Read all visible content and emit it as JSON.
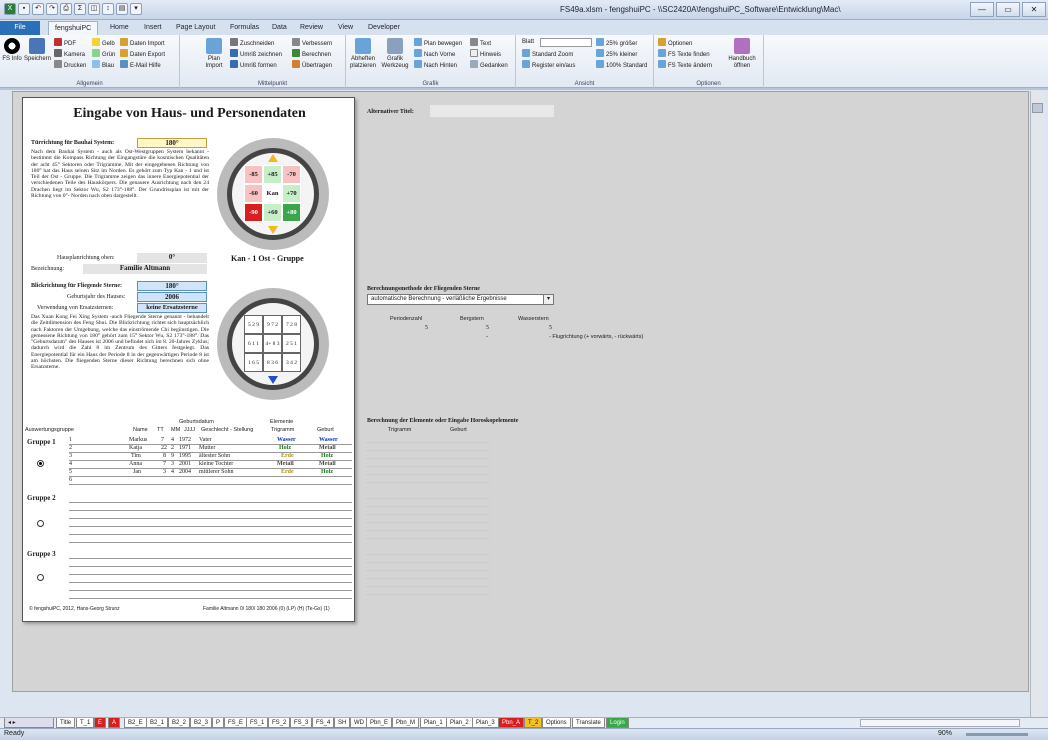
{
  "window": {
    "title": "FS49a.xlsm - fengshuiPC - \\\\SC2420A\\fengshuiPC_Software\\Entwicklung\\Mac\\",
    "btn_min": "—",
    "btn_max": "▭",
    "btn_close": "✕"
  },
  "tabs": [
    "File",
    "fengshuiPC",
    "Home",
    "Insert",
    "Page Layout",
    "Formulas",
    "Data",
    "Review",
    "View",
    "Developer"
  ],
  "ribbon": {
    "allgemein": {
      "label": "Allgemein",
      "fs_info": "FS Info",
      "speichern": "Speichern",
      "pdf": "PDF",
      "kamera": "Kamera",
      "drucken": "Drucken",
      "gelb": "Gelb",
      "gruen": "Grün",
      "blau": "Blau",
      "daten_import": "Daten Import",
      "daten_export": "Daten Export",
      "email": "E-Mail Hilfe"
    },
    "mittelpunkt": {
      "label": "Mittelpunkt",
      "plan_import": "Plan Import",
      "zuschneiden": "Zuschneiden",
      "umriss_zeichnen": "Umriß zeichnen",
      "umriss_formen": "Umriß formen",
      "verbessern": "Verbessern",
      "berechnen": "Berechnen",
      "uebertragen": "Übertragen"
    },
    "grafik": {
      "label": "Grafik",
      "abheften": "Abheften platzieren",
      "werkzeug": "Grafik Werkzeug",
      "plan_bewegen": "Plan bewegen",
      "nach_vorne": "Nach Vorne",
      "nach_hinten": "Nach Hinten",
      "text": "Text",
      "hinweis": "Hinweis",
      "gedanken": "Gedanken"
    },
    "ansicht": {
      "label": "Ansicht",
      "blatt": "Blatt",
      "standard_zoom": "Standard Zoom",
      "register": "Register ein/aus",
      "groesser": "25% größer",
      "kleiner": "25% kleiner",
      "standard100": "100% Standard"
    },
    "optionen": {
      "label": "Optionen",
      "optionen": "Optionen",
      "texte_finden": "FS Texte finden",
      "texte_aendern": "FS Texte ändern",
      "handbuch": "Handbuch öffnen"
    }
  },
  "form": {
    "title": "Eingabe von Haus- und Personendaten",
    "tuer_label": "Türrichtung für Bauhai System:",
    "tuer_value": "180°",
    "tuer_text": "Nach dem Bauhai System - auch als Ost-Westgruppen System bekannt - bestimmt die Kompass Richtung der Eingangstüre die kosmischen Qualitäten der acht 45° Sektoren oder Trigramme. Mit der eingegebenen Richtung von 180° hat das Haus seinen Sitz im Norden. Es gehört zum Typ Kan - 1 und ist Teil der Ost - Gruppe. Die Trigramme zeigen das innere Energiepotential der verschiedenen Teile des Hauskörpers. Die genauere Ausrichtung nach den 24 Drachen liegt im Sektor Wu, S2 173°-188°. Der Grundrissplan ist mit der Richtung von 0°- Norden nach oben dargestellt.",
    "hausplan_label": "Hausplanrichtung oben:",
    "hausplan_value": "0°",
    "bezeichnung_label": "Bezeichnung:",
    "bezeichnung_value": "Familie Altmann",
    "kan_label": "Kan - 1 Ost - Gruppe",
    "blick_label": "Blickrichtung für Fliegende Sterne:",
    "blick_value": "180°",
    "baujahr_label": "Geburtsjahr des Hauses:",
    "baujahr_value": "2006",
    "ersatz_label": "Verwendung von Ersatzsternen:",
    "ersatz_value": "keine Ersatzsterne",
    "blick_text": "Das Xuan Kong Fei Xing System -auch Fliegende Sterne genannt - behandelt die Zeitdimension des Feng Shui. Die Blickrichtung richtet sich hauptsächlich nach Faktoren der Umgebung, welche das einströmende Chi begünstigen. Die gemessene Richtung von 180° gehört zum 15° Sektor Wu, S2 173°-188°. Das \"Geburtsdatum\" des Hauses ist 2006 und befindet sich im 8. 20-Jahres Zyklus; dadurch wird die Zahl 8 im Zentrum des Gitters festgelegt. Das Energiepotential für ein Haus der Periode 8 in der gegenwärtigen Periode 8 ist am höchsten. Die fliegenden Sterne dieser Richtung berechnen sich ohne Ersatzsterne.",
    "bagua": [
      [
        "-85",
        "+85",
        "-70"
      ],
      [
        "-60",
        "Kan",
        "+70"
      ],
      [
        "-90",
        "+60",
        "+80"
      ]
    ],
    "stars": [
      [
        "5 2 9",
        "9 7 2",
        "7 2 8"
      ],
      [
        "6 1 1",
        "4+ 8 3",
        "2 5 1"
      ],
      [
        "1 6 5",
        "8 3 6",
        "3 4 2"
      ]
    ],
    "table_headers": {
      "auswertung": "Auswertungsgruppe",
      "name": "Name",
      "tt": "TT",
      "mm": "MM",
      "jjjj": "JJJJ",
      "geburtsdatum": "Geburtsdatum",
      "geschlecht": "Geschlecht - Stellung",
      "elemente": "Elemente",
      "trigramm": "Trigramm",
      "geburt": "Geburt"
    },
    "groups": [
      "Gruppe 1",
      "Gruppe 2",
      "Gruppe 3"
    ],
    "persons": [
      {
        "nr": "1",
        "name": "Markus",
        "tt": "7",
        "mm": "4",
        "jjjj": "1972",
        "stellung": "Vater",
        "trigramm": "Wasser",
        "geburt": "Wasser"
      },
      {
        "nr": "2",
        "name": "Katja",
        "tt": "22",
        "mm": "2",
        "jjjj": "1971",
        "stellung": "Mutter",
        "trigramm": "Holz",
        "geburt": "Metall"
      },
      {
        "nr": "3",
        "name": "Tim",
        "tt": "8",
        "mm": "9",
        "jjjj": "1995",
        "stellung": "ältester Sohn",
        "trigramm": "Erde",
        "geburt": "Holz"
      },
      {
        "nr": "4",
        "name": "Anna",
        "tt": "7",
        "mm": "3",
        "jjjj": "2001",
        "stellung": "kleine Tochter",
        "trigramm": "Metall",
        "geburt": "Metall"
      },
      {
        "nr": "5",
        "name": "Jan",
        "tt": "3",
        "mm": "4",
        "jjjj": "2004",
        "stellung": "mittlerer Sohn",
        "trigramm": "Erde",
        "geburt": "Holz"
      },
      {
        "nr": "6",
        "name": "",
        "tt": "",
        "mm": "",
        "jjjj": "",
        "stellung": "",
        "trigramm": "",
        "geburt": ""
      }
    ],
    "footer_left": "© fengshuiPC, 2012, Hans-Georg Strunz",
    "footer_right": "Familie Altmann 0/ 180/ 180 2006 (0) (LP) (H) (Te-Gs) (1)"
  },
  "right": {
    "alt_title_label": "Alternativer Titel:",
    "method_title": "Berechnungsmethode der Fliegenden Sterne",
    "method_value": "automatische Berechnung - verläßliche Ergebnisse",
    "periodenzahl": "Periodenzahl",
    "bergstern": "Bergstern",
    "wasserstern": "Wasserstern",
    "p_val": "5",
    "b_val": "5",
    "w_val": "5",
    "flugrichtung": "- Flugrichtung (+ vorwärts, - rückwärts)",
    "dash": "-",
    "elements_title": "Berechnung der Elemente oder Eingabe Horoskopelemente",
    "el_trigramm": "Trigramm",
    "el_geburt": "Geburt"
  },
  "sheets": [
    "Title",
    "T_1",
    "E",
    "A",
    "B2_E",
    "B2_1",
    "B2_2",
    "B2_3",
    "P",
    "FS_E",
    "FS_1",
    "FS_2",
    "FS_3",
    "FS_4",
    "SH",
    "WD",
    "Pbn_E",
    "Pbn_M",
    "Plan_1",
    "Plan_2",
    "Plan_3",
    "Pbn_A",
    "T_2",
    "Options",
    "Translate",
    "Login"
  ],
  "status": {
    "ready": "Ready",
    "zoom": "90%"
  },
  "colors": {
    "red": "#d81e1e",
    "green": "#39a64b",
    "lightgreen": "#c8eec8",
    "lightred": "#f8c2c2",
    "trig_water": "#1030c0",
    "trig_wood": "#1a7a1a",
    "trig_earth": "#b08a1a",
    "trig_metal": "#444"
  }
}
